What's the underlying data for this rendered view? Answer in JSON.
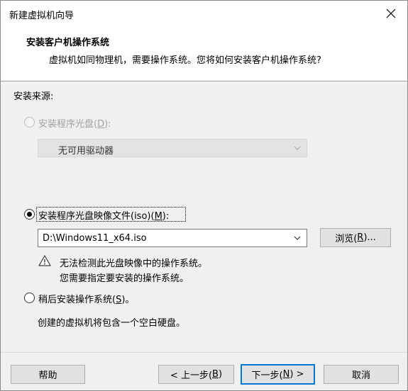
{
  "window": {
    "title": "新建虚拟机向导"
  },
  "header": {
    "title": "安装客户机操作系统",
    "subtitle": "虚拟机如同物理机，需要操作系统。您将如何安装客户机操作系统?"
  },
  "source": {
    "label": "安装来源:",
    "option_disc": {
      "label": "安装程序光盘(",
      "mnemonic": "D",
      "suffix": "):",
      "selected": false,
      "enabled": false
    },
    "disc_select": {
      "value": "无可用驱动器"
    },
    "option_iso": {
      "label": "安装程序光盘映像文件(iso)(",
      "mnemonic": "M",
      "suffix": "):",
      "selected": true,
      "enabled": true
    },
    "iso_path": {
      "value": "D:\\Windows11_x64.iso"
    },
    "browse_button": {
      "label": "浏览(",
      "mnemonic": "R",
      "suffix": ")..."
    },
    "warning": {
      "line1": "无法检测此光盘映像中的操作系统。",
      "line2": "您需要指定要安装的操作系统。"
    },
    "option_later": {
      "label": "稍后安装操作系统(",
      "mnemonic": "S",
      "suffix": ")。",
      "selected": false,
      "enabled": true
    },
    "later_description": "创建的虚拟机将包含一个空白硬盘。"
  },
  "footer": {
    "help": "帮助",
    "back": {
      "label": "< 上一步(",
      "mnemonic": "B",
      "suffix": ")"
    },
    "next": {
      "label": "下一步(",
      "mnemonic": "N",
      "suffix": ") >"
    },
    "cancel": "取消"
  },
  "colors": {
    "accent": "#0078d7",
    "dialog_bg": "#f0f0f0",
    "disabled_text": "#a0a0a0"
  }
}
